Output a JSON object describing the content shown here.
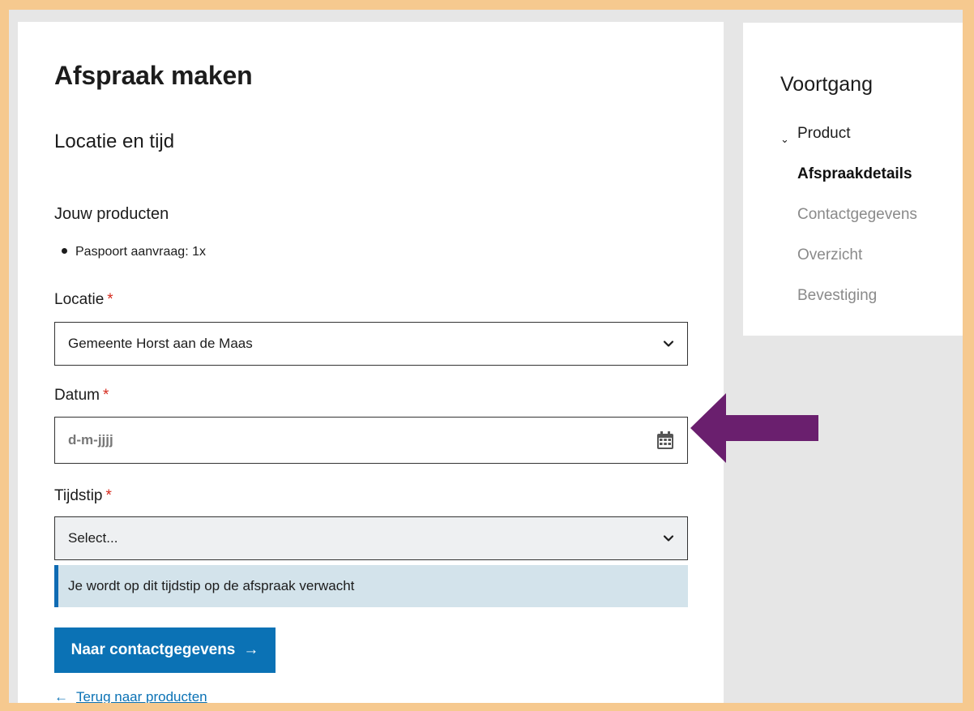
{
  "page": {
    "title": "Afspraak maken",
    "subtitle": "Locatie en tijd"
  },
  "products": {
    "label": "Jouw producten",
    "items": [
      "Paspoort aanvraag: 1x"
    ]
  },
  "form": {
    "required_marker": "*",
    "location": {
      "label": "Locatie",
      "value": "Gemeente Horst aan de Maas"
    },
    "date": {
      "label": "Datum",
      "placeholder": "d-m-jjjj"
    },
    "time": {
      "label": "Tijdstip",
      "value": "Select..."
    },
    "info_text": "Je wordt op dit tijdstip op de afspraak verwacht",
    "next_button": "Naar contactgegevens",
    "next_arrow": "→",
    "back_arrow": "←",
    "back_link": "Terug naar producten"
  },
  "progress": {
    "title": "Voortgang",
    "done_mark": "⌄",
    "steps": [
      {
        "label": "Product",
        "state": "done"
      },
      {
        "label": "Afspraakdetails",
        "state": "active"
      },
      {
        "label": "Contactgegevens",
        "state": "todo"
      },
      {
        "label": "Overzicht",
        "state": "todo"
      },
      {
        "label": "Bevestiging",
        "state": "todo"
      }
    ]
  },
  "colors": {
    "frame": "#f6c98f",
    "accent": "#0b72b5",
    "required": "#d52b1e",
    "annotation_arrow": "#6a1f6e"
  }
}
